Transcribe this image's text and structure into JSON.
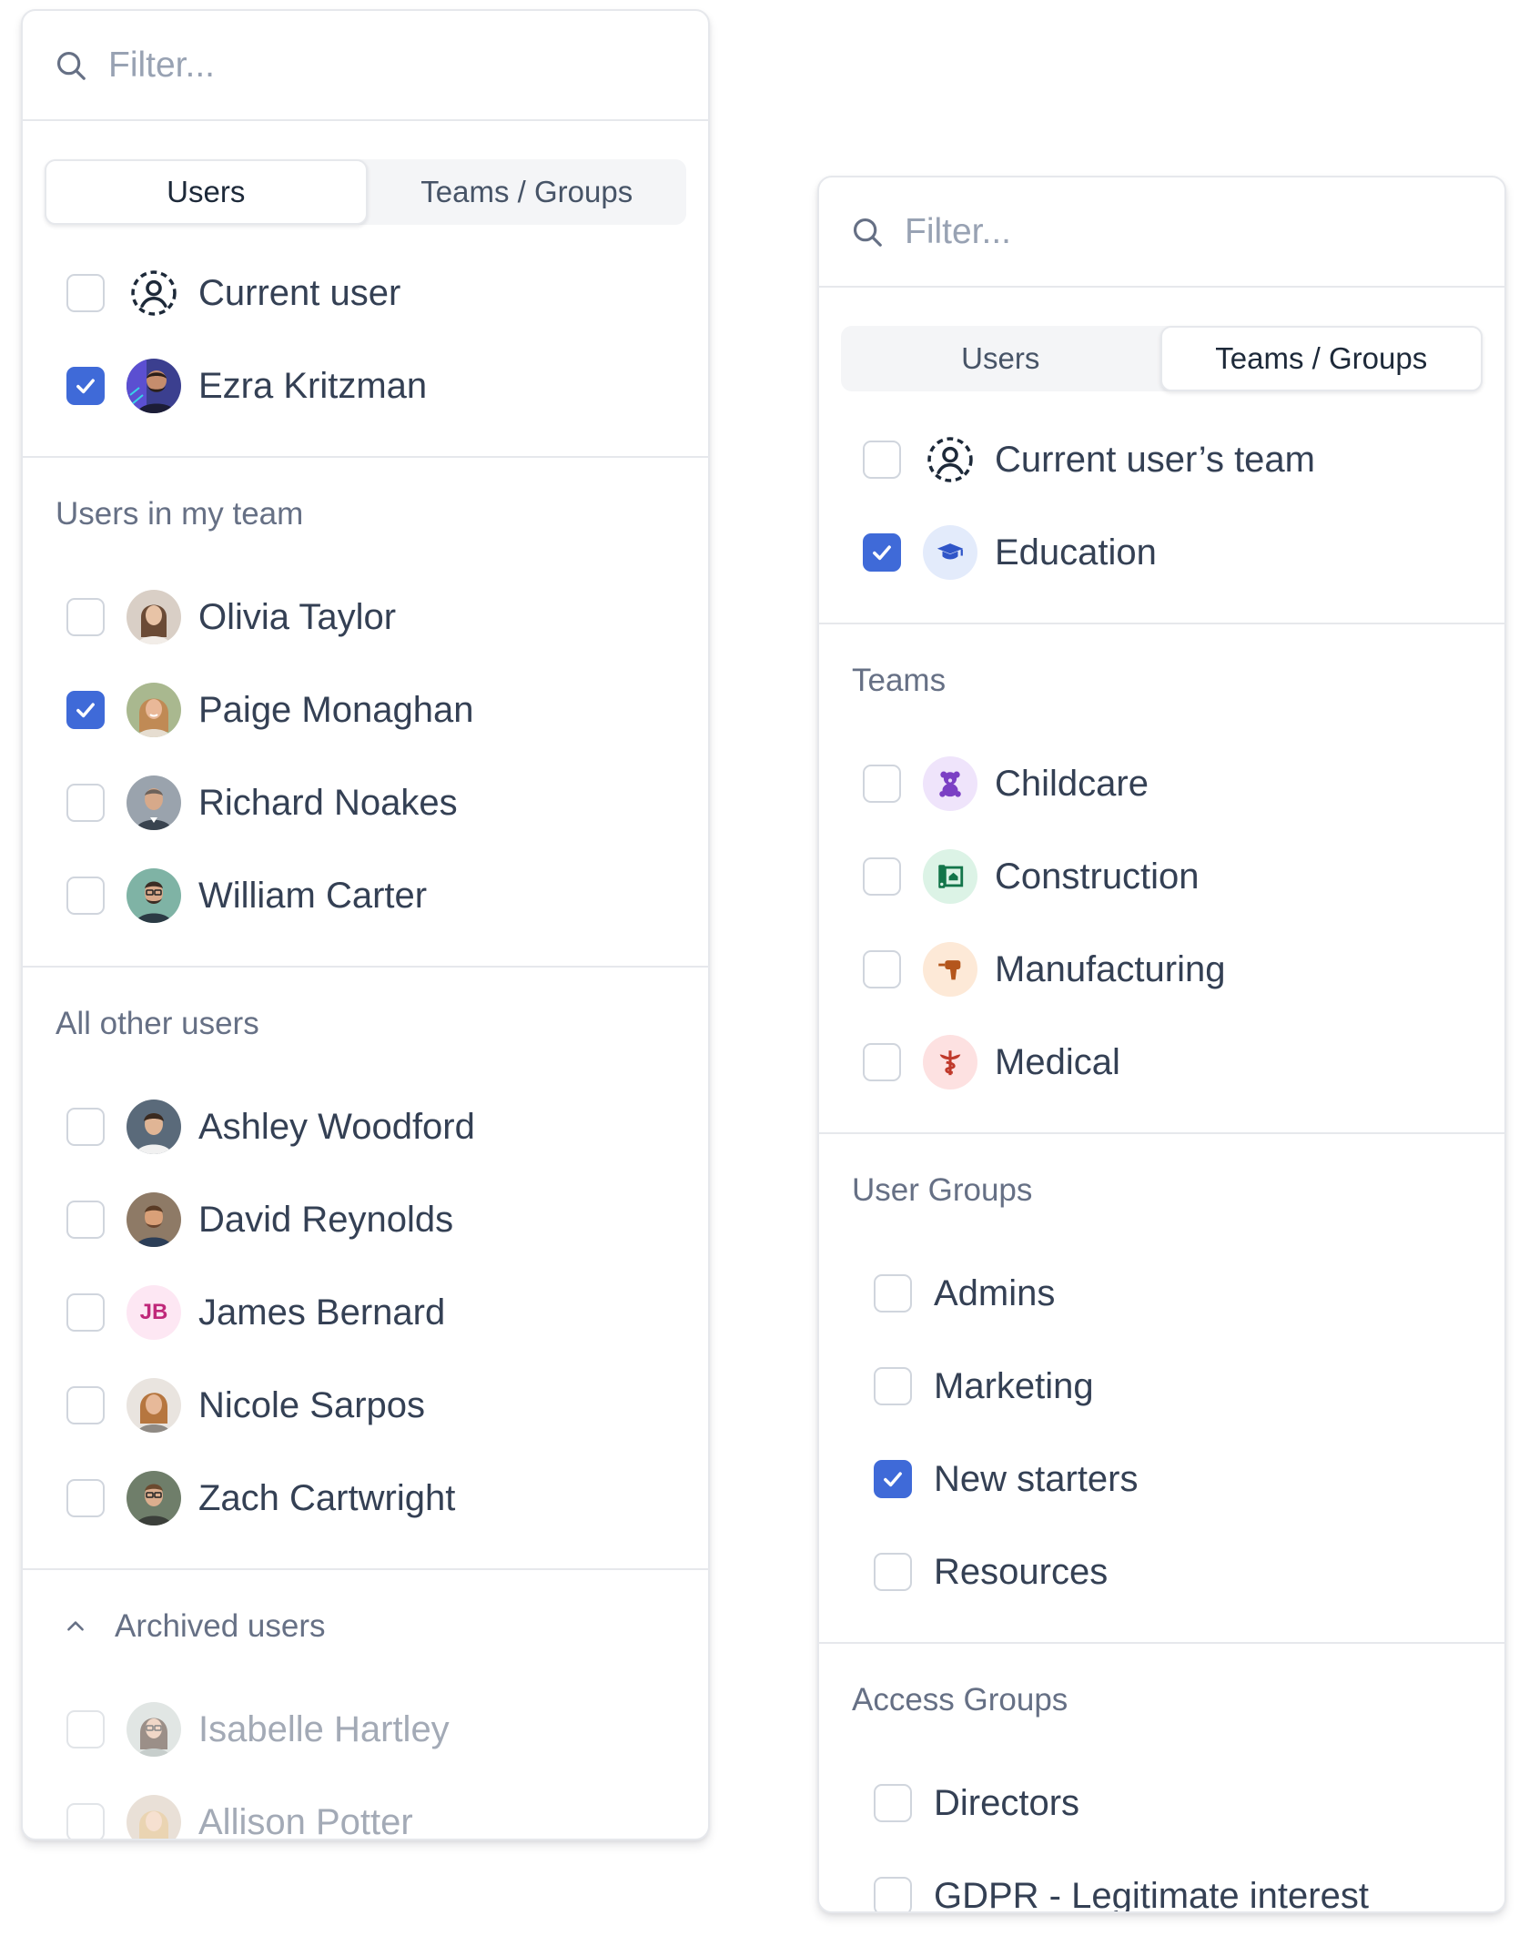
{
  "users_panel": {
    "search": {
      "placeholder": "Filter..."
    },
    "tabs": [
      {
        "label": "Users",
        "active": true
      },
      {
        "label": "Teams / Groups",
        "active": false
      }
    ],
    "top_items": [
      {
        "label": "Current user",
        "checked": false,
        "icon": "user-circle-dashed-icon"
      },
      {
        "label": "Ezra Kritzman",
        "checked": true,
        "avatar": "photo"
      }
    ],
    "my_team": {
      "title": "Users in my team",
      "items": [
        {
          "label": "Olivia Taylor",
          "checked": false
        },
        {
          "label": "Paige Monaghan",
          "checked": true
        },
        {
          "label": "Richard Noakes",
          "checked": false
        },
        {
          "label": "William Carter",
          "checked": false
        }
      ]
    },
    "other_users": {
      "title": "All other users",
      "items": [
        {
          "label": "Ashley Woodford",
          "checked": false
        },
        {
          "label": "David Reynolds",
          "checked": false
        },
        {
          "label": "James Bernard",
          "checked": false,
          "initials": "JB"
        },
        {
          "label": "Nicole Sarpos",
          "checked": false
        },
        {
          "label": "Zach Cartwright",
          "checked": false
        }
      ]
    },
    "archived": {
      "title": "Archived users",
      "items": [
        {
          "label": "Isabelle Hartley",
          "checked": false
        },
        {
          "label": "Allison Potter",
          "checked": false
        }
      ]
    }
  },
  "teams_panel": {
    "search": {
      "placeholder": "Filter..."
    },
    "tabs": [
      {
        "label": "Users",
        "active": false
      },
      {
        "label": "Teams / Groups",
        "active": true
      }
    ],
    "top_items": [
      {
        "label": "Current user’s team",
        "checked": false,
        "icon": "user-circle-dashed-icon"
      },
      {
        "label": "Education",
        "checked": true,
        "icon": "graduation-cap-icon"
      }
    ],
    "teams": {
      "title": "Teams",
      "items": [
        {
          "label": "Childcare",
          "checked": false,
          "icon": "teddy-bear-icon"
        },
        {
          "label": "Construction",
          "checked": false,
          "icon": "blueprint-icon"
        },
        {
          "label": "Manufacturing",
          "checked": false,
          "icon": "drill-icon"
        },
        {
          "label": "Medical",
          "checked": false,
          "icon": "caduceus-icon"
        }
      ]
    },
    "user_groups": {
      "title": "User Groups",
      "items": [
        {
          "label": "Admins",
          "checked": false
        },
        {
          "label": "Marketing",
          "checked": false
        },
        {
          "label": "New starters",
          "checked": true
        },
        {
          "label": "Resources",
          "checked": false
        }
      ]
    },
    "access_groups": {
      "title": "Access Groups",
      "items": [
        {
          "label": "Directors",
          "checked": false
        },
        {
          "label": "GDPR - Legitimate interest",
          "checked": false
        }
      ]
    }
  },
  "colors": {
    "accent": "#3f6ad8",
    "border": "#e6e8ec",
    "text": "#344054",
    "muted": "#667085"
  }
}
